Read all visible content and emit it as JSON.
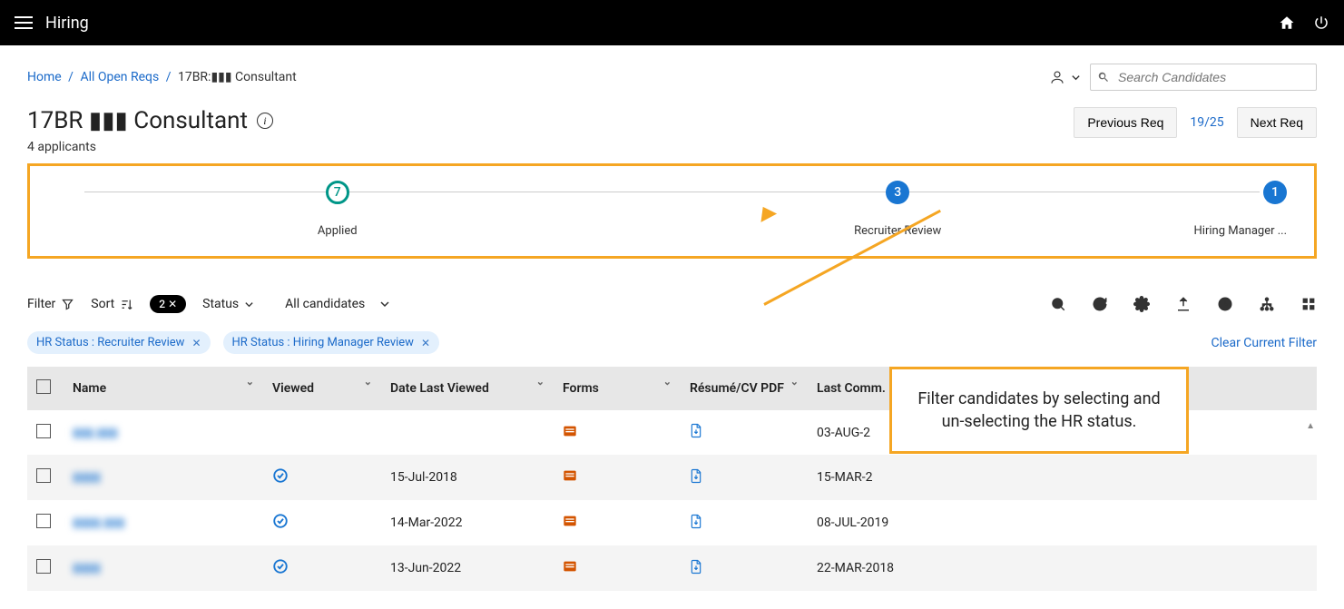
{
  "topbar": {
    "title": "Hiring"
  },
  "breadcrumb": {
    "home": "Home",
    "openreqs": "All Open Reqs",
    "current": "17BR:▮▮▮ Consultant"
  },
  "search": {
    "placeholder": "Search Candidates"
  },
  "page": {
    "title": "17BR ▮▮▮ Consultant",
    "applicants": "4 applicants"
  },
  "reqnav": {
    "prev": "Previous Req",
    "counter": "19/25",
    "next": "Next Req"
  },
  "pipeline": {
    "stages": [
      {
        "count": "7",
        "label": "Applied",
        "style": "outline"
      },
      {
        "count": "3",
        "label": "Recruiter Review",
        "style": "fill"
      },
      {
        "count": "1",
        "label": "Hiring Manager ...",
        "style": "fill"
      }
    ]
  },
  "toolbar": {
    "filter": "Filter",
    "sort": "Sort",
    "badge": "2 ✕",
    "status": "Status",
    "allcand": "All candidates"
  },
  "chips": [
    "HR Status : Recruiter Review",
    "HR Status : Hiring Manager Review"
  ],
  "clear": "Clear Current Filter",
  "columns": {
    "name": "Name",
    "viewed": "Viewed",
    "datelv": "Date Last Viewed",
    "forms": "Forms",
    "resume": "Résumé/CV PDF",
    "lastcomm": "Last Comm."
  },
  "rows": [
    {
      "name": "▮▮▮ ▮▮▮",
      "viewed": false,
      "date": "",
      "lastcomm": "03-AUG-2"
    },
    {
      "name": "▮▮▮▮",
      "viewed": true,
      "date": "15-Jul-2018",
      "lastcomm": "15-MAR-2"
    },
    {
      "name": "▮▮▮▮ ▮▮▮",
      "viewed": true,
      "date": "14-Mar-2022",
      "lastcomm": "08-JUL-2019"
    },
    {
      "name": "▮▮▮▮",
      "viewed": true,
      "date": "13-Jun-2022",
      "lastcomm": "22-MAR-2018"
    }
  ],
  "callout": "Filter candidates by selecting and un-selecting the HR status."
}
